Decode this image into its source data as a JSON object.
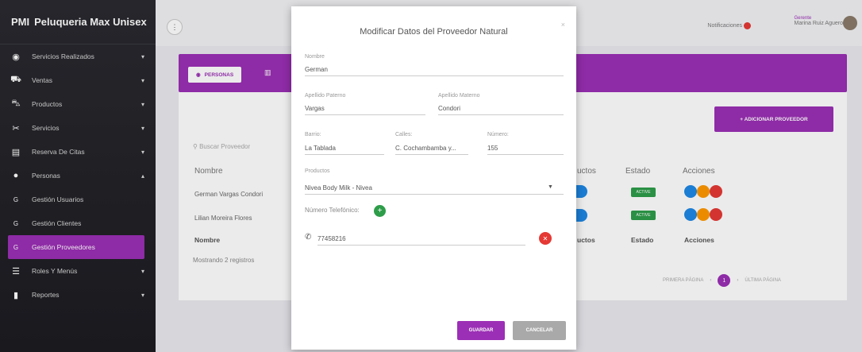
{
  "app": {
    "brand_prefix": "PMI",
    "brand_name": "Peluqueria Max Unisex"
  },
  "sidebar": {
    "items": [
      {
        "label": "Servicios Realizados",
        "icon": "eye-icon"
      },
      {
        "label": "Ventas",
        "icon": "cart-icon"
      },
      {
        "label": "Productos",
        "icon": "cart-plus-icon"
      },
      {
        "label": "Servicios",
        "icon": "scissors-icon"
      },
      {
        "label": "Reserva De Citas",
        "icon": "calendar-icon"
      },
      {
        "label": "Personas",
        "icon": "person-icon"
      },
      {
        "label": "Gestión Usuarios",
        "icon": "g-icon"
      },
      {
        "label": "Gestión Clientes",
        "icon": "g-icon"
      },
      {
        "label": "Gestión Proveedores",
        "icon": "g-icon"
      },
      {
        "label": "Roles Y Menús",
        "icon": "list-icon"
      },
      {
        "label": "Reportes",
        "icon": "report-icon"
      }
    ],
    "active_index": 8
  },
  "topbar": {
    "notifications": "Notificaciones",
    "user_role": "Gerente",
    "user_name": "Marina Ruiz Aguero"
  },
  "main": {
    "tab_personas": "PERSONAS",
    "add_button": "+ ADICIONAR PROVEEDOR",
    "search_placeholder": "Buscar Proveedor",
    "headers": {
      "nombre": "Nombre",
      "productos": "uctos",
      "estado": "Estado",
      "acciones": "Acciones"
    },
    "rows": [
      {
        "nombre": "German Vargas Condori",
        "estado": "ACTIVE"
      },
      {
        "nombre": "Lilian Moreira Flores",
        "estado": "ACTIVE"
      }
    ],
    "footer": {
      "nombre": "Nombre",
      "productos": "uctos",
      "estado": "Estado",
      "acciones": "Acciones"
    },
    "records": "Mostrando 2 registros",
    "pager": {
      "first": "PRIMERA PÁGINA",
      "current": "1",
      "last": "ÚLTIMA PÁGINA"
    }
  },
  "modal": {
    "title": "Modificar Datos del Proveedor Natural",
    "close": "×",
    "fields": {
      "nombre": {
        "label": "Nombre",
        "value": "German"
      },
      "apellido_paterno": {
        "label": "Apellido Paterno",
        "value": "Vargas"
      },
      "apellido_materno": {
        "label": "Apellido Materno",
        "value": "Condori"
      },
      "barrio": {
        "label": "Barrio:",
        "value": "La Tablada"
      },
      "calles": {
        "label": "Calles:",
        "value": "C. Cochambamba y..."
      },
      "numero": {
        "label": "Número:",
        "value": "155"
      },
      "productos": {
        "label": "Productos",
        "value": "Nivea Body Milk - Nivea"
      },
      "telefono": {
        "label": "Número Telefónico:",
        "value": "77458216"
      }
    },
    "save": "GUARDAR",
    "cancel": "CANCELAR"
  },
  "colors": {
    "accent": "#9b2fb5",
    "sidebar": "#1c1c21",
    "active": "#2e9d4a",
    "danger": "#e53935",
    "edit": "#ff9800",
    "view": "#1e88e5"
  }
}
